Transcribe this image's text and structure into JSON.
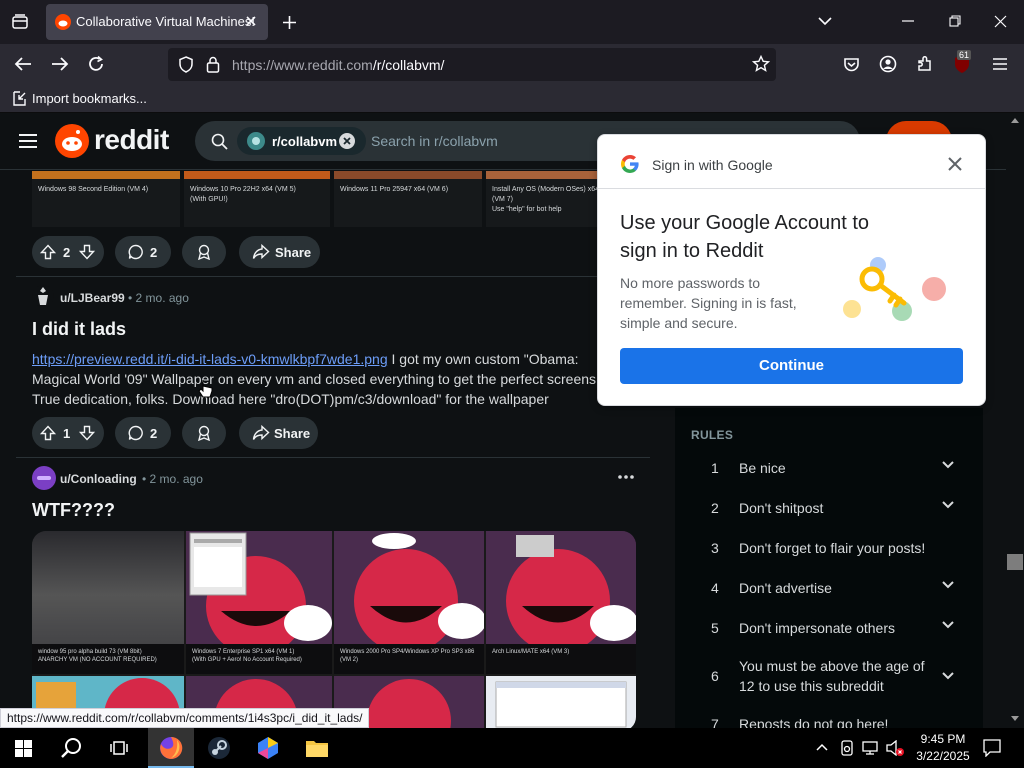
{
  "browser": {
    "tab_title": "Collaborative Virtual Machines!",
    "url_host": "https://www.reddit.com",
    "url_path": "/r/collabvm/",
    "extension_badge": "61",
    "bookmark_label": "Import bookmarks..."
  },
  "reddit": {
    "logo_text": "reddit",
    "subreddit_chip": "r/collabvm",
    "search_placeholder": "Search in r/collabvm"
  },
  "post_top": {
    "thumbs": [
      "Windows 98 Second Edition (VM 4)",
      "Windows 10 Pro 22H2 x64 (VM 5)\n(With GPU!)",
      "Windows 11 Pro 25947 x64 (VM 6)",
      "Install Any OS (Modern OSes) x64\n(VM 7)\nUse \"help\" for bot help"
    ],
    "upvotes": "2",
    "comments": "2",
    "share_label": "Share"
  },
  "post1": {
    "author": "u/LJBear99",
    "age": "• 2 mo. ago",
    "title": "I did it lads",
    "link": "https://preview.redd.it/i-did-it-lads-v0-kmwlkbpf7wde1.png",
    "body_line1_rest": " I got my own custom \"Obama:",
    "body_line2": "Magical World '09\" Wallpaper on every vm and closed everything to get the perfect screens",
    "body_line3": "True dedication, folks. Download here \"dro(DOT)pm/c3/download\" for the wallpaper",
    "upvotes": "1",
    "comments": "2",
    "share_label": "Share"
  },
  "post2": {
    "author": "u/Conloading",
    "age": "• 2 mo. ago",
    "title": "WTF????",
    "captions": [
      "window 95 pro alpha build 73 (VM 8bit)\nANARCHY VM (NO ACCOUNT REQUIRED)",
      "Windows 7 Enterprise SP1 x64 (VM 1)\n(With GPU + Aero! No Account Required)",
      "Windows 2000 Pro SP4/Windows XP Pro SP3 x86\n(VM 2)",
      "Arch Linux/MATE x64 (VM 3)"
    ]
  },
  "sidebar": {
    "heading": "RULES",
    "rules": [
      {
        "num": "1",
        "text": "Be nice"
      },
      {
        "num": "2",
        "text": "Don't shitpost"
      },
      {
        "num": "3",
        "text": "Don't forget to flair your posts!"
      },
      {
        "num": "4",
        "text": "Don't advertise"
      },
      {
        "num": "5",
        "text": "Don't impersonate others"
      },
      {
        "num": "6",
        "text": "You must be above the age of 12 to use this subreddit"
      },
      {
        "num": "7",
        "text": "Reposts do not go here!"
      }
    ]
  },
  "google_popup": {
    "header": "Sign in with Google",
    "heading": "Use your Google Account to sign in to Reddit",
    "paragraph": "No more passwords to remember. Signing in is fast, simple and secure.",
    "button": "Continue"
  },
  "status_url": "https://www.reddit.com/r/collabvm/comments/1i4s3pc/i_did_it_lads/",
  "taskbar": {
    "time": "9:45 PM",
    "date": "3/22/2025"
  },
  "colors": {
    "reddit_orange": "#ff4500",
    "google_blue": "#1a73e8",
    "link_blue": "#6d9ef9"
  }
}
